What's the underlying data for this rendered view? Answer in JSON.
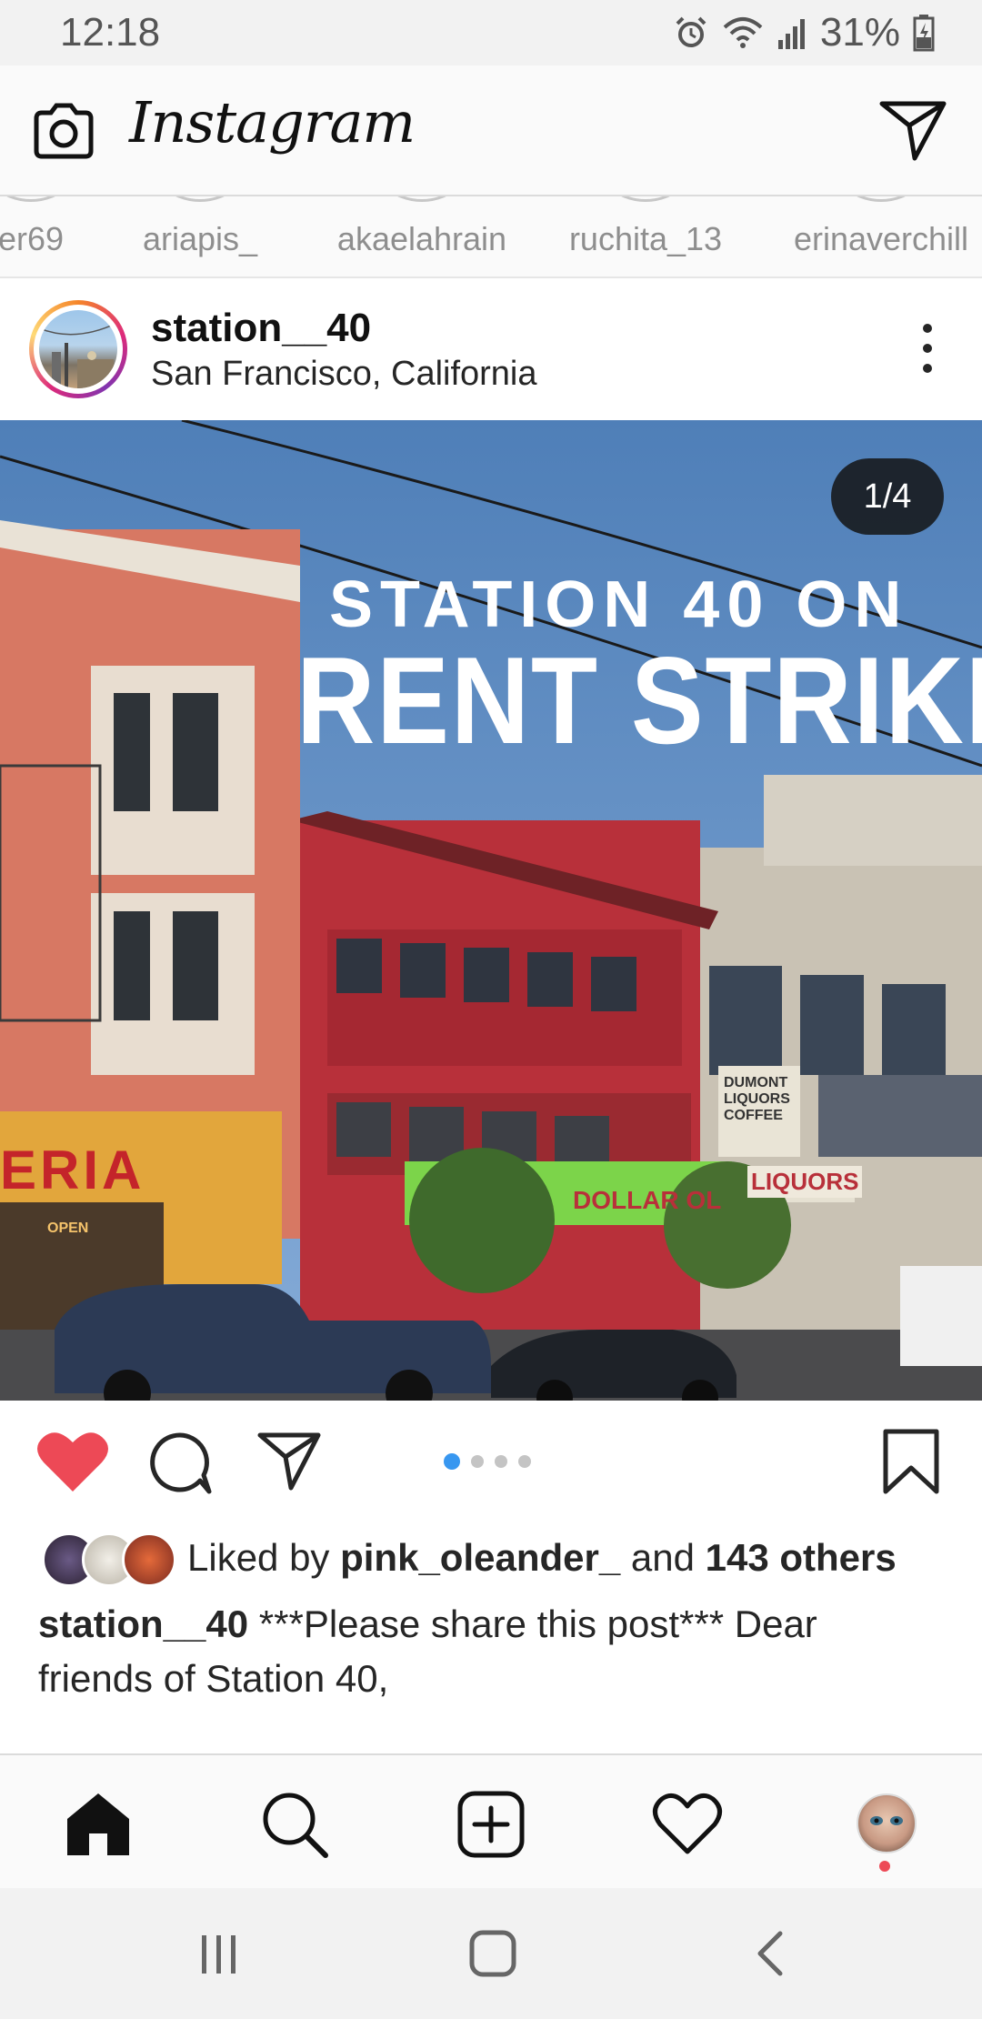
{
  "status_bar": {
    "time": "12:18",
    "battery": "31%",
    "icons": [
      "alarm-icon",
      "wifi-icon",
      "signal-icon",
      "battery-charging-icon"
    ]
  },
  "header": {
    "logo": "Instagram",
    "camera_icon": "camera-icon",
    "direct_icon": "paper-plane-icon"
  },
  "stories": [
    {
      "name": "er69"
    },
    {
      "name": "ariapis_"
    },
    {
      "name": "akaelahrain"
    },
    {
      "name": "ruchita_13"
    },
    {
      "name": "erinaverchill"
    }
  ],
  "post": {
    "username": "station__40",
    "location": "San Francisco, California",
    "more_icon": "more-vertical-icon",
    "carousel": {
      "counter": "1/4",
      "current": 1,
      "total": 4
    },
    "overlay": {
      "line1": "STATION 40 ON",
      "line2": "RENT STRIKE"
    },
    "signs": {
      "storefront": "ERIA",
      "dollar": "DOLLAR OL",
      "liquors": "LIQUORS",
      "dumont": "DUMONT LIQUORS COFFEE",
      "open": "OPEN"
    },
    "actions": {
      "liked": true,
      "icons": [
        "heart-icon",
        "comment-icon",
        "share-icon",
        "bookmark-icon"
      ]
    },
    "likes": {
      "prefix": "Liked by",
      "user": "pink_oleander_",
      "conjunction": "and",
      "others": "143 others"
    },
    "caption": {
      "username": "station__40",
      "text": "***Please share this post*** Dear friends of Station 40,"
    }
  },
  "bottom_nav": {
    "items": [
      "home-icon",
      "search-icon",
      "new-post-icon",
      "activity-heart-icon",
      "profile-avatar"
    ],
    "active": "home"
  },
  "colors": {
    "like_red": "#ed4956",
    "carousel_dot_active": "#3897f0",
    "text": "#262626",
    "muted": "#8e8e8e"
  }
}
